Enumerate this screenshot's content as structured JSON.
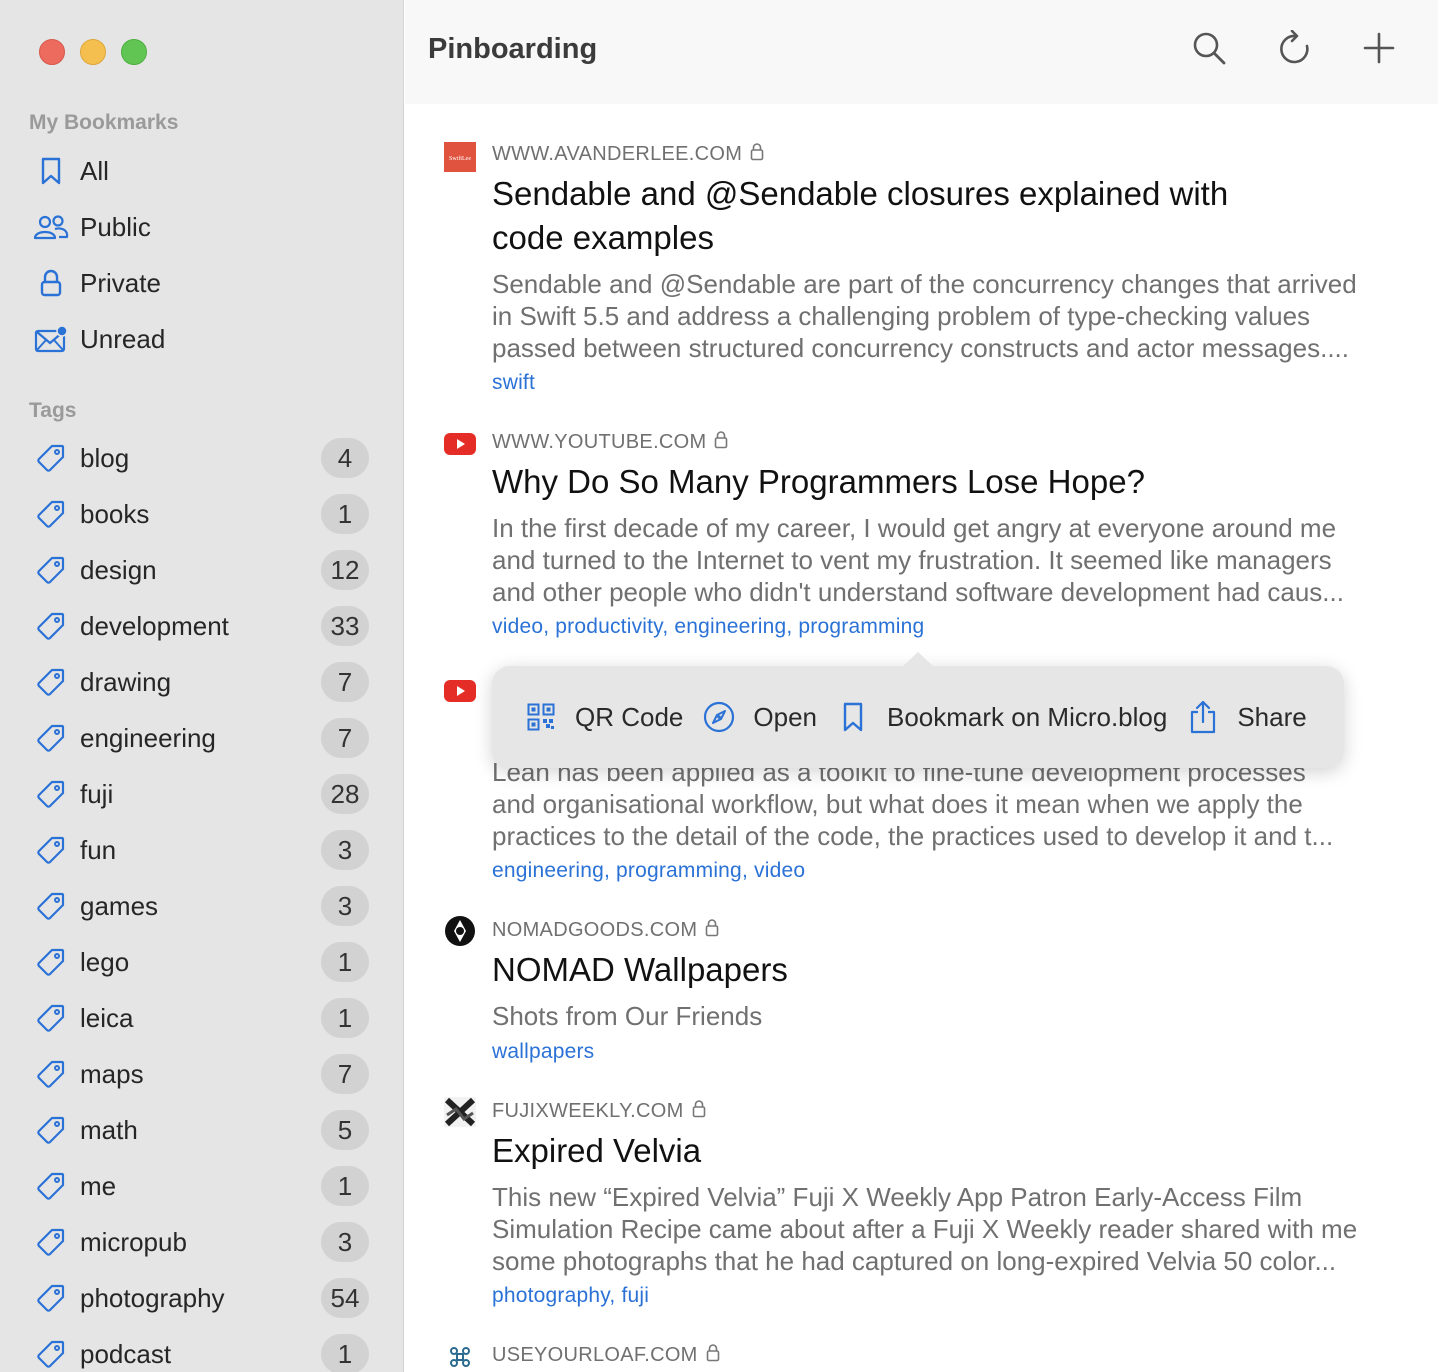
{
  "sidebar": {
    "my_bookmarks_title": "My Bookmarks",
    "items": [
      {
        "label": "All",
        "icon": "bookmark-icon"
      },
      {
        "label": "Public",
        "icon": "people-icon"
      },
      {
        "label": "Private",
        "icon": "lock-icon"
      },
      {
        "label": "Unread",
        "icon": "envelope-badge-icon"
      }
    ],
    "tags_title": "Tags",
    "tags": [
      {
        "label": "blog",
        "count": "4"
      },
      {
        "label": "books",
        "count": "1"
      },
      {
        "label": "design",
        "count": "12"
      },
      {
        "label": "development",
        "count": "33"
      },
      {
        "label": "drawing",
        "count": "7"
      },
      {
        "label": "engineering",
        "count": "7"
      },
      {
        "label": "fuji",
        "count": "28"
      },
      {
        "label": "fun",
        "count": "3"
      },
      {
        "label": "games",
        "count": "3"
      },
      {
        "label": "lego",
        "count": "1"
      },
      {
        "label": "leica",
        "count": "1"
      },
      {
        "label": "maps",
        "count": "7"
      },
      {
        "label": "math",
        "count": "5"
      },
      {
        "label": "me",
        "count": "1"
      },
      {
        "label": "micropub",
        "count": "3"
      },
      {
        "label": "photography",
        "count": "54"
      },
      {
        "label": "podcast",
        "count": "1"
      }
    ]
  },
  "toolbar": {
    "title": "Pinboarding",
    "buttons": [
      "search-icon",
      "refresh-icon",
      "plus-icon"
    ]
  },
  "entries": [
    {
      "domain": "WWW.AVANDERLEE.COM",
      "title_line1": "Sendable and @Sendable closures explained with",
      "title_line2": "code examples",
      "desc1": "Sendable and @Sendable are part of the concurrency changes that arrived",
      "desc2": "in Swift 5.5 and address a challenging problem of type-checking values",
      "desc3": "passed between structured concurrency constructs and actor messages....",
      "tags": "swift"
    },
    {
      "domain": "WWW.YOUTUBE.COM",
      "title_line1": "Why Do So Many Programmers Lose Hope?",
      "desc1": "In the first decade of my career, I would get angry at everyone around me",
      "desc2": "and turned to the Internet to vent my frustration. It seemed like managers",
      "desc3": "and other people who didn't understand software development had caus...",
      "tags": "video, productivity, engineering, programming"
    },
    {
      "domain": "",
      "desc1": "Lean has been applied as a toolkit to fine-tune development processes",
      "desc2": "and organisational workflow, but what does it mean when we apply the",
      "desc3": "practices to the detail of the code, the practices used to develop it and t...",
      "tags": "engineering, programming, video"
    },
    {
      "domain": "NOMADGOODS.COM",
      "title_line1": "NOMAD Wallpapers",
      "desc1": "Shots from Our Friends",
      "tags": "wallpapers"
    },
    {
      "domain": "FUJIXWEEKLY.COM",
      "title_line1": "Expired Velvia",
      "desc1": "This new “Expired Velvia” Fuji X Weekly App Patron Early-Access Film",
      "desc2": "Simulation Recipe came about after a Fuji X Weekly reader shared with me",
      "desc3": "some photographs that he had captured on long-expired Velvia 50 color...",
      "tags": "photography, fuji"
    },
    {
      "domain": "USEYOURLOAF.COM"
    }
  ],
  "popover": {
    "items": [
      {
        "label": "QR Code",
        "icon": "qr-code-icon"
      },
      {
        "label": "Open",
        "icon": "compass-icon"
      },
      {
        "label": "Bookmark on Micro.blog",
        "icon": "bookmark-icon"
      },
      {
        "label": "Share",
        "icon": "share-icon"
      }
    ]
  },
  "colors": {
    "accent": "#2b72d6",
    "sidebar_bg": "#e5e5e5",
    "traffic_red": "#ed6a5e",
    "traffic_yellow": "#f5bf4f",
    "traffic_green": "#61c554",
    "youtube_red": "#e52d27"
  }
}
